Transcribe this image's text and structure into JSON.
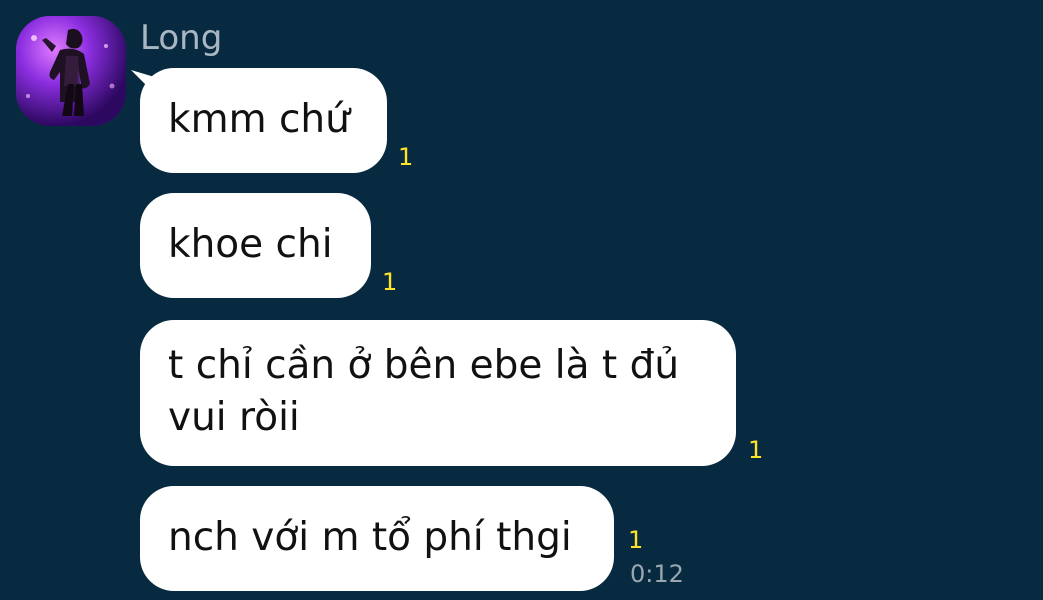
{
  "sender": {
    "name": "Long"
  },
  "messages": [
    {
      "text": "kmm chứ",
      "unread": "1"
    },
    {
      "text": "khoe chi",
      "unread": "1"
    },
    {
      "text": "t chỉ cần ở bên ebe là t đủ vui ròii",
      "unread": "1"
    },
    {
      "text": "nch với m tổ phí thgi",
      "unread": "1",
      "time": "0:12"
    }
  ],
  "colors": {
    "background": "#082a40",
    "bubble": "#ffffff",
    "unread_count": "#ffe22a",
    "sender_name": "#a9b7c3"
  }
}
